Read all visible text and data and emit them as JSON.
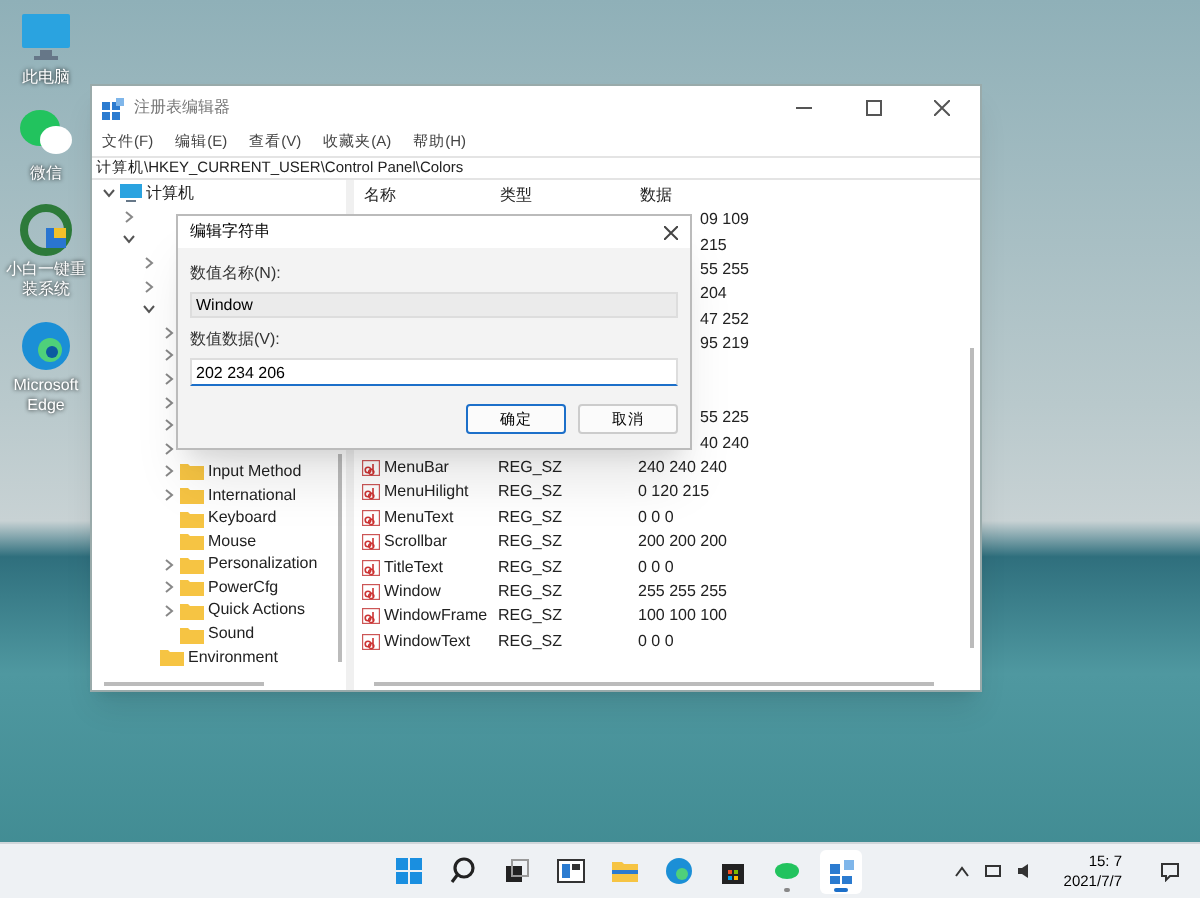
{
  "desktop_icons": [
    {
      "label": "此电脑",
      "kind": "pc"
    },
    {
      "label": "微信",
      "kind": "chat"
    },
    {
      "label": "小白一键重装系统",
      "kind": "tool"
    },
    {
      "label": "Microsoft Edge",
      "kind": "edge"
    }
  ],
  "window": {
    "title": "注册表编辑器",
    "menu": [
      "文件(F)",
      "编辑(E)",
      "查看(V)",
      "收藏夹(A)",
      "帮助(H)"
    ],
    "address": "计算机\\HKEY_CURRENT_USER\\Control Panel\\Colors",
    "tree": [
      {
        "kind": "computer",
        "label": "计算机",
        "expanded": true,
        "children": [
          {
            "kind": "covered",
            "expanded": false
          },
          {
            "kind": "covered",
            "expanded": true,
            "children": [
              {
                "kind": "covered",
                "expanded": false
              },
              {
                "kind": "covered",
                "expanded": false
              },
              {
                "kind": "covered",
                "expanded": true,
                "children": [
                  {
                    "kind": "covered",
                    "expanded": false
                  },
                  {
                    "kind": "covered",
                    "expanded": false
                  },
                  {
                    "kind": "covered",
                    "expanded": false
                  },
                  {
                    "kind": "covered",
                    "expanded": false
                  },
                  {
                    "kind": "covered",
                    "expanded": false
                  },
                  {
                    "kind": "covered",
                    "expanded": false
                  },
                  {
                    "kind": "folder",
                    "label": "Input Method",
                    "expanded": false
                  },
                  {
                    "kind": "folder",
                    "label": "International",
                    "expanded": false
                  },
                  {
                    "kind": "leaf",
                    "label": "Keyboard"
                  },
                  {
                    "kind": "leaf",
                    "label": "Mouse"
                  },
                  {
                    "kind": "folder",
                    "label": "Personalization",
                    "expanded": false
                  },
                  {
                    "kind": "folder",
                    "label": "PowerCfg",
                    "expanded": false
                  },
                  {
                    "kind": "folder",
                    "label": "Quick Actions",
                    "expanded": false
                  },
                  {
                    "kind": "leaf",
                    "label": "Sound"
                  }
                ]
              },
              {
                "kind": "leaf",
                "label": "Environment"
              }
            ]
          }
        ]
      }
    ],
    "columns": [
      "名称",
      "类型",
      "数据"
    ],
    "values": [
      {
        "kind": "partial",
        "data": "09 109"
      },
      {
        "kind": "partial",
        "data": "215"
      },
      {
        "kind": "partial",
        "data": "55 255"
      },
      {
        "kind": "partial",
        "data": "204"
      },
      {
        "kind": "partial",
        "data": "47 252"
      },
      {
        "kind": "partial",
        "data": "95 219"
      },
      {
        "kind": "covered"
      },
      {
        "kind": "covered"
      },
      {
        "kind": "partial",
        "data": "55 225"
      },
      {
        "kind": "partial",
        "data": "40 240"
      },
      {
        "kind": "full",
        "name": "MenuBar",
        "type": "REG_SZ",
        "data": "240 240 240"
      },
      {
        "kind": "full",
        "name": "MenuHilight",
        "type": "REG_SZ",
        "data": "0 120 215"
      },
      {
        "kind": "full",
        "name": "MenuText",
        "type": "REG_SZ",
        "data": "0 0 0"
      },
      {
        "kind": "full",
        "name": "Scrollbar",
        "type": "REG_SZ",
        "data": "200 200 200"
      },
      {
        "kind": "full",
        "name": "TitleText",
        "type": "REG_SZ",
        "data": "0 0 0"
      },
      {
        "kind": "full",
        "name": "Window",
        "type": "REG_SZ",
        "data": "255 255 255"
      },
      {
        "kind": "full",
        "name": "WindowFrame",
        "type": "REG_SZ",
        "data": "100 100 100"
      },
      {
        "kind": "full",
        "name": "WindowText",
        "type": "REG_SZ",
        "data": "0 0 0"
      }
    ]
  },
  "dialog": {
    "title": "编辑字符串",
    "name_label": "数值名称(N):",
    "name_value": "Window",
    "data_label": "数值数据(V):",
    "data_value": "202 234 206",
    "buttons": [
      {
        "label": "确定",
        "default": true
      },
      {
        "label": "取消",
        "default": false
      }
    ]
  },
  "taskbar": {
    "apps": [
      {
        "kind": "start"
      },
      {
        "kind": "search"
      },
      {
        "kind": "taskview"
      },
      {
        "kind": "widgets"
      },
      {
        "kind": "explorer"
      },
      {
        "kind": "edge"
      },
      {
        "kind": "store"
      },
      {
        "kind": "chat",
        "running": true
      },
      {
        "kind": "regedit",
        "running": true,
        "selected": true
      }
    ],
    "time": "15: 7",
    "date": "2021/7/7"
  }
}
